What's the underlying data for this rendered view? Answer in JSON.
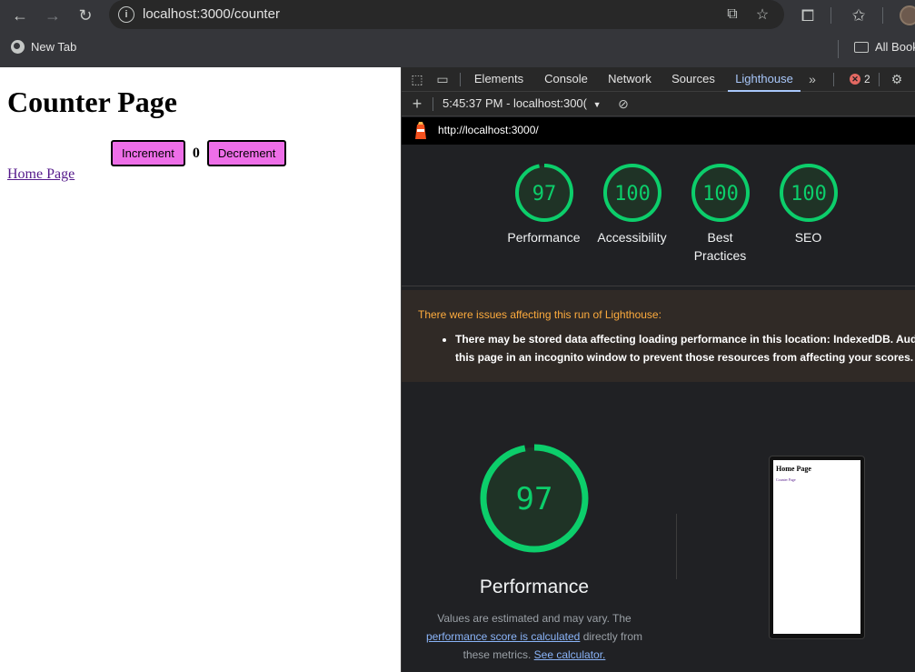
{
  "browser": {
    "url": "localhost:3000/counter",
    "bookmarks": {
      "new_tab": "New Tab",
      "all_bookmarks": "All Book"
    }
  },
  "page": {
    "title": "Counter Page",
    "increment_label": "Increment",
    "count": "0",
    "decrement_label": "Decrement",
    "home_link": "Home Page"
  },
  "devtools": {
    "tabs": [
      "Elements",
      "Console",
      "Network",
      "Sources",
      "Lighthouse"
    ],
    "active_tab": "Lighthouse",
    "error_count": "2",
    "run_selector": "5:45:37 PM - localhost:300(",
    "report_url": "http://localhost:3000/",
    "scores": [
      {
        "label": "Performance",
        "score": 97,
        "display": "97"
      },
      {
        "label": "Accessibility",
        "score": 100,
        "display": "100"
      },
      {
        "label": "Best Practices",
        "score": 100,
        "display": "100"
      },
      {
        "label": "SEO",
        "score": 100,
        "display": "100"
      }
    ],
    "warnings": {
      "title": "There were issues affecting this run of Lighthouse:",
      "item_line1": "There may be stored data affecting loading performance in this location: IndexedDB. Aud",
      "item_line2": "this page in an incognito window to prevent those resources from affecting your scores."
    },
    "performance": {
      "score": 97,
      "display": "97",
      "title": "Performance",
      "note_pre": "Values are estimated and may vary. The",
      "note_link1": "performance score is calculated",
      "note_mid": "directly from these metrics.",
      "note_link2": "See calculator."
    },
    "screenshot_thumb": {
      "title": "Home Page",
      "link": "Counter Page"
    }
  },
  "colors": {
    "score_good": "#0cce6b",
    "score_good_bg": "#1f3326",
    "button_pink": "#ee6ee8",
    "active_tab": "#a8c7fa",
    "warning_title": "#fdab3d"
  }
}
